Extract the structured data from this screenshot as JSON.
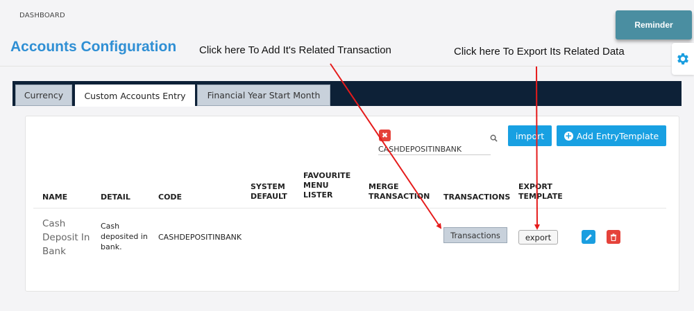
{
  "breadcrumb": "DASHBOARD",
  "page_title": "Accounts Configuration",
  "annotations": {
    "transaction_hint": "Click here To Add It's Related Transaction",
    "export_hint": "Click here To Export Its Related Data"
  },
  "reminder_label": "Reminder",
  "tabs": [
    {
      "label": "Currency",
      "active": false
    },
    {
      "label": "Custom Accounts Entry",
      "active": true
    },
    {
      "label": "Financial Year Start Month",
      "active": false
    }
  ],
  "toolbar": {
    "clear_symbol": "✖",
    "search_value": "CASHDEPOSITINBANK",
    "import_label": "import",
    "add_label": "Add EntryTemplate",
    "plus_symbol": "+"
  },
  "table": {
    "headers": {
      "name": "NAME",
      "detail": "DETAIL",
      "code": "CODE",
      "system_default": "SYSTEM\nDEFAULT",
      "favourite": "FAVOURITE\nMENU\nLISTER",
      "merge": "MERGE\nTRANSACTION",
      "transactions": "TRANSACTIONS",
      "export": "EXPORT\nTEMPLATE"
    },
    "rows": [
      {
        "name": "Cash Deposit In Bank",
        "detail": "Cash deposited in bank.",
        "code": "CASHDEPOSITINBANK",
        "transactions_label": "Transactions",
        "export_label": "export"
      }
    ]
  },
  "colors": {
    "title": "#2f8fd4",
    "primary_button": "#18a0e2",
    "danger": "#e5423a",
    "tabbar": "#0d2137",
    "reminder": "#4a8ea1",
    "arrow": "#e51b1b"
  },
  "icons": [
    "gear-icon",
    "search-icon",
    "plus-circle-icon",
    "pencil-icon",
    "trash-icon",
    "close-icon"
  ]
}
